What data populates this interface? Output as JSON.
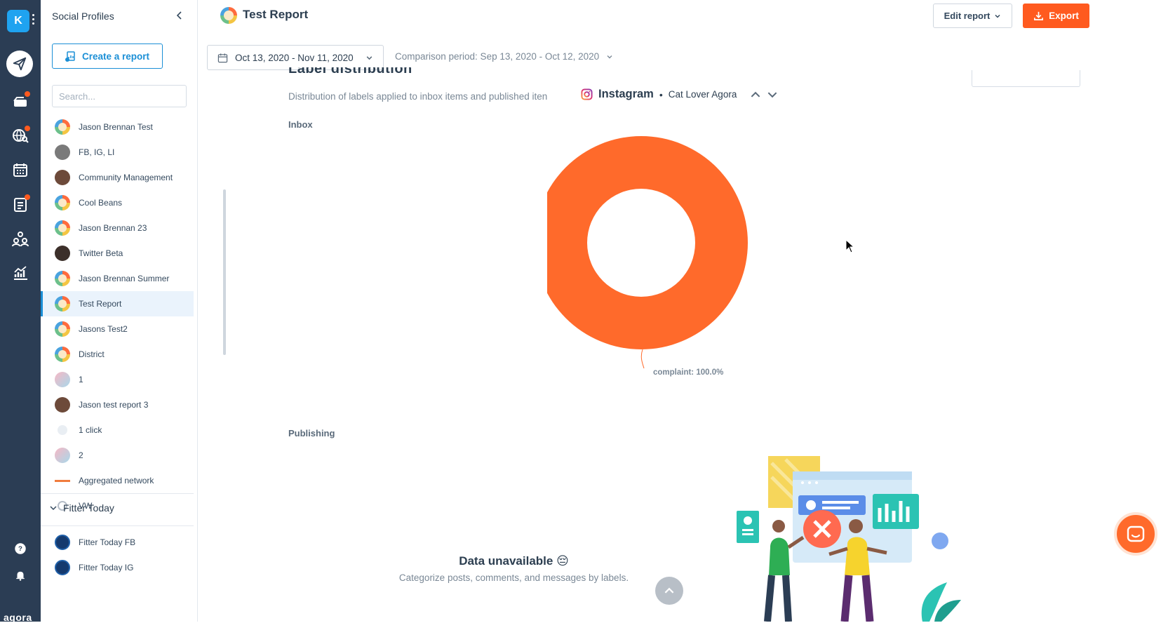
{
  "rail": {
    "workspace_initial": "K",
    "brand": "agora",
    "nav": [
      {
        "icon": "paper-plane-icon"
      },
      {
        "icon": "inbox-icon",
        "badge": true
      },
      {
        "icon": "globe-search-icon",
        "badge": true
      },
      {
        "icon": "calendar-icon"
      },
      {
        "icon": "clipboard-icon",
        "badge": true
      },
      {
        "icon": "team-icon"
      },
      {
        "icon": "analytics-icon"
      },
      {
        "icon": "help-icon"
      },
      {
        "icon": "bell-icon"
      }
    ]
  },
  "sidebar": {
    "title": "Social Profiles",
    "create_label": "Create a report",
    "search_placeholder": "Search...",
    "items": [
      {
        "label": "Jason Brennan Test",
        "avatar": "rainbow"
      },
      {
        "label": "FB, IG, LI",
        "avatar": "grey"
      },
      {
        "label": "Community Management",
        "avatar": "brown"
      },
      {
        "label": "Cool Beans",
        "avatar": "rainbow"
      },
      {
        "label": "Jason Brennan 23",
        "avatar": "rainbow"
      },
      {
        "label": "Twitter Beta",
        "avatar": "dark"
      },
      {
        "label": "Jason Brennan Summer",
        "avatar": "rainbow"
      },
      {
        "label": "Test Report",
        "avatar": "rainbow",
        "active": true
      },
      {
        "label": "Jasons Test2",
        "avatar": "rainbow"
      },
      {
        "label": "District",
        "avatar": "rainbow"
      },
      {
        "label": "1",
        "avatar": "pastel"
      },
      {
        "label": "Jason test report 3",
        "avatar": "brown"
      },
      {
        "label": "1 click",
        "avatar": "small"
      },
      {
        "label": "2",
        "avatar": "pastel"
      },
      {
        "label": "Aggregated network",
        "avatar": "text"
      },
      {
        "label": "VW",
        "avatar": "wheel"
      }
    ],
    "group_label": "Fitter Today",
    "group_items": [
      {
        "label": "Fitter Today FB",
        "avatar": "blue"
      },
      {
        "label": "Fitter Today IG",
        "avatar": "blue"
      }
    ]
  },
  "header": {
    "title": "Test Report",
    "edit_label": "Edit report",
    "export_label": "Export"
  },
  "filters": {
    "date_range": "Oct 13, 2020 - Nov 11, 2020",
    "comparison": "Comparison period: Sep 13, 2020 - Oct 12, 2020"
  },
  "section": {
    "title": "Label distribution",
    "subtitle": "Distribution of labels applied to inbox items and published iten",
    "network": "Instagram",
    "bullet": "•",
    "profile": "Cat Lover Agora",
    "inbox_label": "Inbox",
    "publishing_label": "Publishing",
    "unavailable_title": "Data unavailable 😔",
    "unavailable_sub": "Categorize posts, comments, and messages by labels."
  },
  "chart_data": {
    "type": "pie",
    "variant": "donut",
    "categories": [
      "complaint"
    ],
    "values": [
      100.0
    ],
    "labels": [
      "complaint: 100.0%"
    ],
    "colors": [
      "#ff6a2b"
    ]
  },
  "colors": {
    "rail_bg": "#2b3d54",
    "accent": "#1b8fd6",
    "export": "#ff5a1f",
    "donut": "#ff6a2b"
  }
}
